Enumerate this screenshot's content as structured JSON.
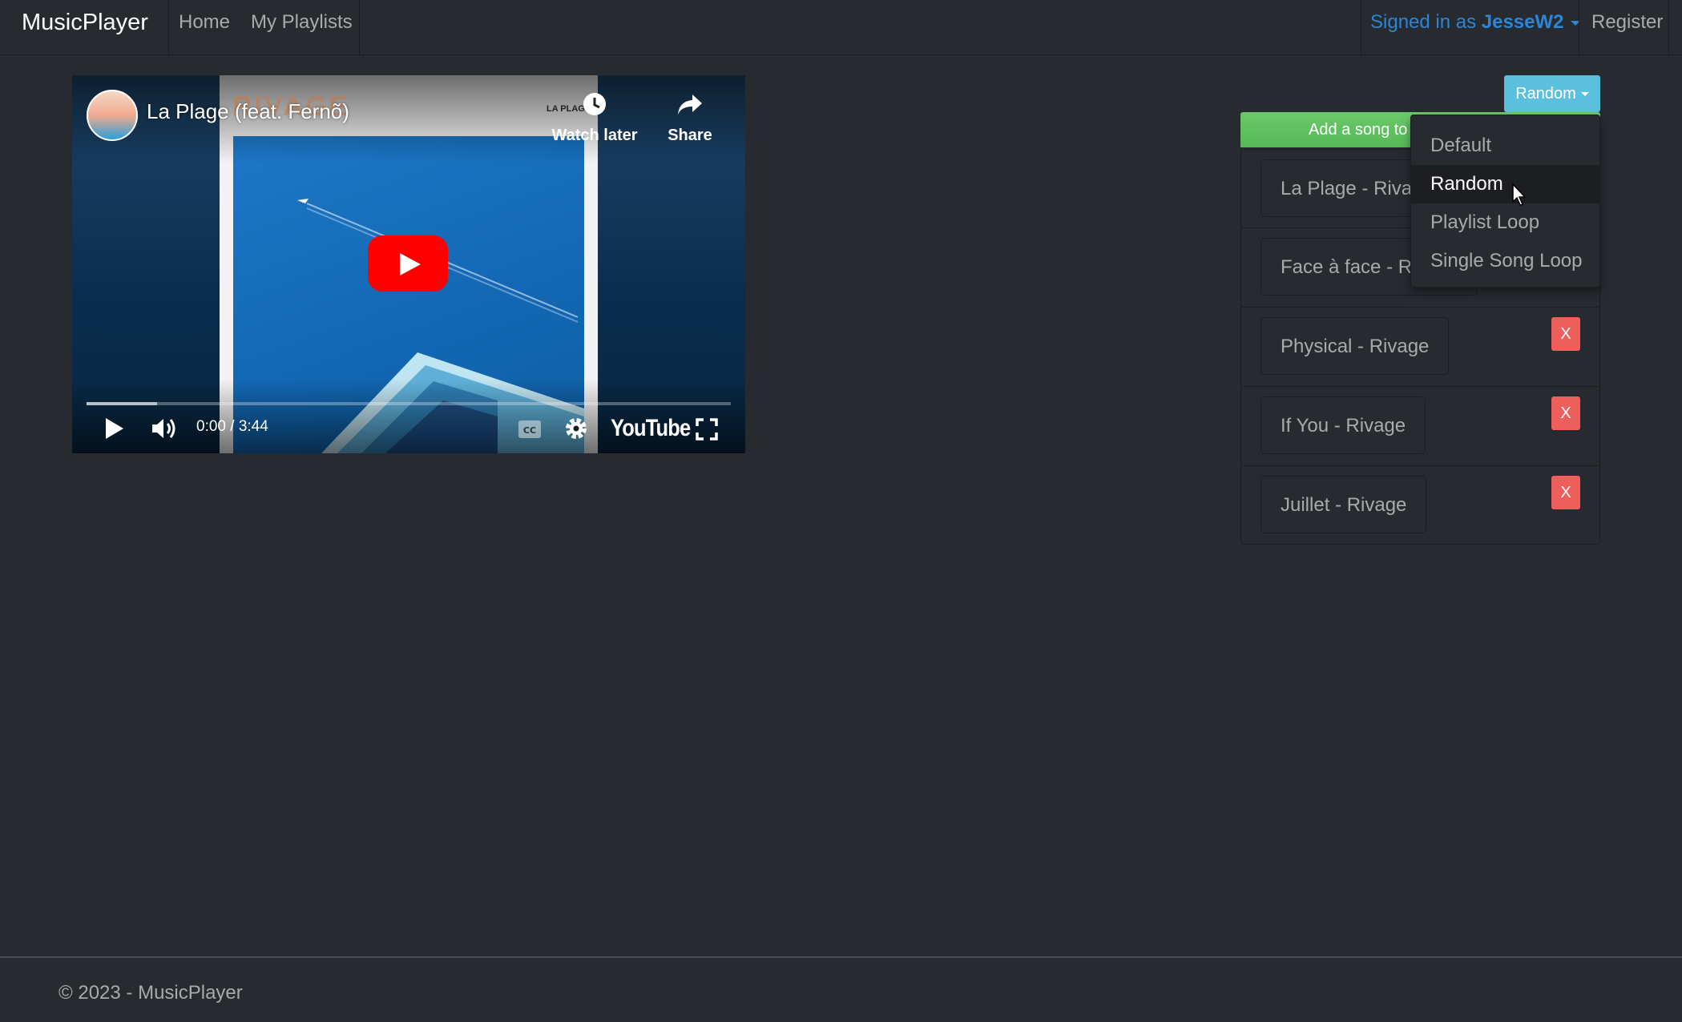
{
  "navbar": {
    "brand": "MusicPlayer",
    "links": [
      "Home",
      "My Playlists"
    ],
    "user_prefix": "Signed in as",
    "username": "JesseW2",
    "register": "Register"
  },
  "video": {
    "title": "La Plage (feat. Fernõ)",
    "watch_later": "Watch later",
    "share": "Share",
    "time": "0:00 / 3:44",
    "progress": 0.11,
    "artwork_title": "RIVAGE",
    "artwork_subtitle": "LA PLAGE",
    "logo_text": "YouTube",
    "icons": [
      "play-icon",
      "volume-icon",
      "captions-icon",
      "settings-icon",
      "fullscreen-icon",
      "clock-icon",
      "share-icon"
    ]
  },
  "playlist": {
    "mode_button": "Random",
    "add_song": "Add a song to",
    "remove_label": "X",
    "songs": [
      "La Plage - Rivage",
      "Face à face - Rivage",
      "Physical - Rivage",
      "If You - Rivage",
      "Juillet - Rivage"
    ],
    "modes": [
      "Default",
      "Random",
      "Playlist Loop",
      "Single Song Loop"
    ],
    "selected_mode": "Random"
  },
  "colors": {
    "background": "#272b30",
    "info": "#5bc0de",
    "success": "#62c462",
    "danger": "#ee5f5b",
    "link": "#2b86d8"
  },
  "footer": {
    "text": "© 2023 - MusicPlayer"
  }
}
